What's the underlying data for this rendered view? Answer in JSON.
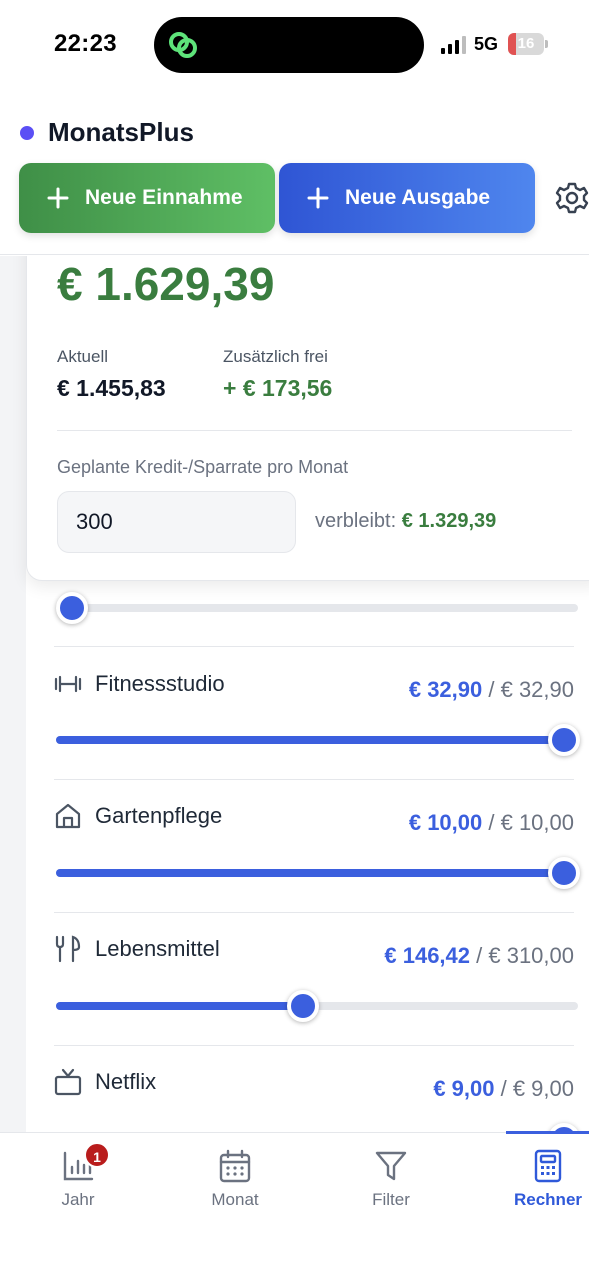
{
  "status_bar": {
    "time": "22:23",
    "network": "5G",
    "battery": "16"
  },
  "header": {
    "app_name": "MonatsPlus",
    "brand_color": "#5b4ff5",
    "income_button": "Neue Einnahme",
    "expense_button": "Neue Ausgabe"
  },
  "summary": {
    "total": "€ 1.629,39",
    "current_label": "Aktuell",
    "current_value": "€ 1.455,83",
    "extra_label": "Zusätzlich frei",
    "extra_value": "+ € 173,56",
    "rate_label": "Geplante Kredit-/Sparrate pro Monat",
    "rate_value": "300",
    "remaining_label": "verbleibt:",
    "remaining_value": "€ 1.329,39",
    "rate_slider_fraction": 0.0
  },
  "budgets": [
    {
      "name": "Fitnessstudio",
      "icon": "dumbbell-icon",
      "spent": "€ 32,90",
      "sep": " / ",
      "limit": "€ 32,90",
      "fraction": 1.0
    },
    {
      "name": "Gartenpflege",
      "icon": "house-icon",
      "spent": "€ 10,00",
      "sep": " / ",
      "limit": "€ 10,00",
      "fraction": 1.0
    },
    {
      "name": "Lebensmittel",
      "icon": "utensils-icon",
      "spent": "€ 146,42",
      "sep": " / ",
      "limit": "€ 310,00",
      "fraction": 0.4723
    },
    {
      "name": "Netflix",
      "icon": "tv-icon",
      "spent": "€ 9,00",
      "sep": " / ",
      "limit": "€ 9,00",
      "fraction": 1.0
    }
  ],
  "tabs": [
    {
      "label": "Jahr",
      "icon": "bar-chart-icon",
      "badge": "1"
    },
    {
      "label": "Monat",
      "icon": "calendar-icon"
    },
    {
      "label": "Filter",
      "icon": "filter-icon"
    },
    {
      "label": "Rechner",
      "icon": "calculator-icon",
      "active": true
    }
  ],
  "colors": {
    "income": "#4caf50",
    "expense": "#3b5fde",
    "positive": "#3a7d3f"
  }
}
